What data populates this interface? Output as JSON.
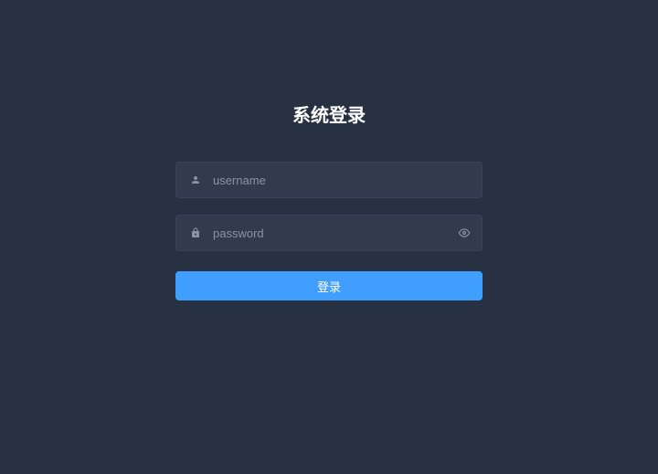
{
  "login": {
    "title": "系统登录",
    "username_placeholder": "username",
    "password_placeholder": "password",
    "button_label": "登录"
  }
}
